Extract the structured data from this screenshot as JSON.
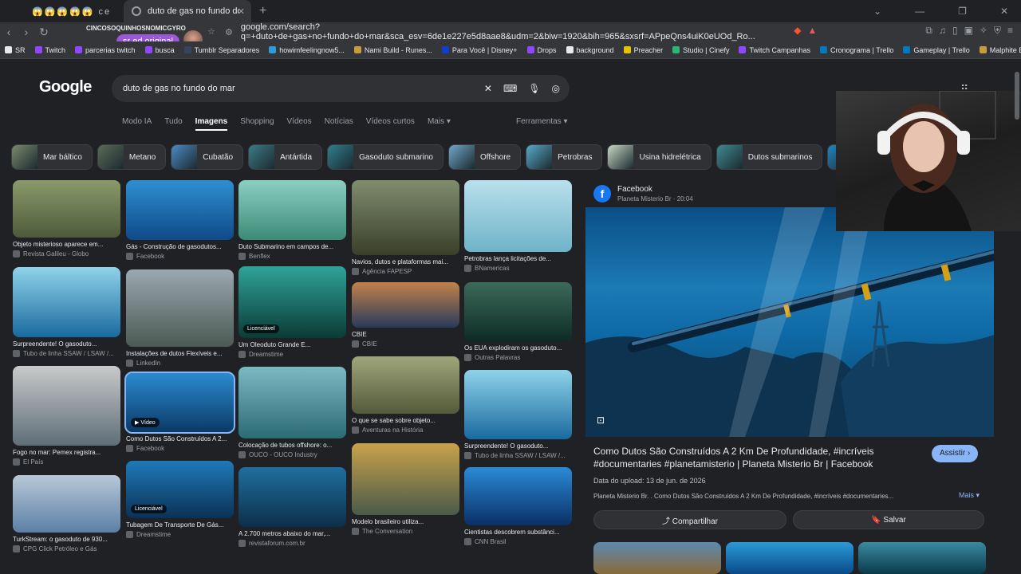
{
  "browser": {
    "tabs": [
      {
        "title": "😱😱😱😱😱 ce",
        "active": false
      },
      {
        "title": "duto de gas no fundo do mar - Pe",
        "active": true
      }
    ],
    "overlay_text": "CINCOSOQUINHOSNOMICGYRO",
    "stream_pill": "sr ed original",
    "url": "google.com/search?q=+duto+de+gas+no+fundo+do+mar&sca_esv=6de1e227e5d8aae8&udm=2&biw=1920&bih=965&sxsrf=APpeQns4uiK0eUOd_Ro...",
    "bookmarks": [
      {
        "label": "SR",
        "color": "#e8eaed"
      },
      {
        "label": "Twitch",
        "color": "#9146ff"
      },
      {
        "label": "parcerias twitch",
        "color": "#9146ff"
      },
      {
        "label": "busca",
        "color": "#9146ff"
      },
      {
        "label": "Tumblr Separadores",
        "color": "#35465c"
      },
      {
        "label": "howimfeelingnow5...",
        "color": "#2d9cdb"
      },
      {
        "label": "Nami Build - Runes...",
        "color": "#c89b3c"
      },
      {
        "label": "Para Você | Disney+",
        "color": "#113ccf"
      },
      {
        "label": "Drops",
        "color": "#9146ff"
      },
      {
        "label": "background",
        "color": "#e8eaed"
      },
      {
        "label": "Preacher",
        "color": "#e6c300"
      },
      {
        "label": "Studio | Cinefy",
        "color": "#2bb673"
      },
      {
        "label": "Twitch Campanhas",
        "color": "#9146ff"
      },
      {
        "label": "Cronograma | Trello",
        "color": "#0079bf"
      },
      {
        "label": "Gameplay | Trello",
        "color": "#0079bf"
      },
      {
        "label": "Malphite Build - Ru...",
        "color": "#c89b3c"
      }
    ]
  },
  "search": {
    "logo": "Google",
    "query": "duto de gas no fundo do mar",
    "tabs": [
      "Modo IA",
      "Tudo",
      "Imagens",
      "Shopping",
      "Vídeos",
      "Notícias",
      "Vídeos curtos",
      "Mais ▾"
    ],
    "selected_tab": "Imagens",
    "tools": "Ferramentas ▾"
  },
  "chips": [
    {
      "label": "Mar báltico",
      "color": "#7b8a6a"
    },
    {
      "label": "Metano",
      "color": "#5c6b55"
    },
    {
      "label": "Cubatão",
      "color": "#4d89c4"
    },
    {
      "label": "Antártida",
      "color": "#3c7c86"
    },
    {
      "label": "Gasoduto submarino",
      "color": "#2f7e8e"
    },
    {
      "label": "Offshore",
      "color": "#6fa7c7"
    },
    {
      "label": "Petrobras",
      "color": "#57a9c9"
    },
    {
      "label": "Usina hidrelétrica",
      "color": "#c9d6c3"
    },
    {
      "label": "Dutos submarinos",
      "color": "#3f8a8f"
    },
    {
      "label": "T",
      "color": "#1f86c2"
    }
  ],
  "results": [
    {
      "caption": "Objeto misterioso aparece em...",
      "source": "Revista Galileu - Globo",
      "badge": "",
      "colors": [
        "#8a9a6a",
        "#4d5a3a"
      ]
    },
    {
      "caption": "Surpreendente! O gasoduto...",
      "source": "Tubo de linha SSAW / LSAW /...",
      "badge": "",
      "colors": [
        "#8fd3ea",
        "#1a6aa0"
      ]
    },
    {
      "caption": "Fogo no mar: Pemex registra...",
      "source": "El País",
      "badge": "",
      "colors": [
        "#c9c9c9",
        "#5e6e78"
      ]
    },
    {
      "caption": "TurkStream: o gasoduto de 930...",
      "source": "CPG Click Petróleo e Gás",
      "badge": "",
      "colors": [
        "#b8c9d8",
        "#5b7fa5"
      ]
    },
    {
      "caption": "Gás - Construção de gasodutos...",
      "source": "Facebook",
      "badge": "",
      "colors": [
        "#2e8fd0",
        "#0f4a8a"
      ]
    },
    {
      "caption": "Instalações de dutos Flexíveis e...",
      "source": "LinkedIn",
      "badge": "",
      "colors": [
        "#9aa8b0",
        "#4b5a52"
      ]
    },
    {
      "caption": "Como Dutos São Construídos A 2...",
      "source": "Facebook",
      "badge": "▶ Vídeo",
      "colors": [
        "#2b8bd0",
        "#0b3a66"
      ]
    },
    {
      "caption": "Tubagem De Transporte De Gás...",
      "source": "Dreamstime",
      "badge": "Licenciável",
      "colors": [
        "#1e7ab8",
        "#0a3257"
      ]
    },
    {
      "caption": "Duto Submarino em campos de...",
      "source": "Benflex",
      "badge": "",
      "colors": [
        "#8ccfc3",
        "#3c8a78"
      ]
    },
    {
      "caption": "Um Oleoduto Grande E...",
      "source": "Dreamstime",
      "badge": "Licenciável",
      "colors": [
        "#2fa39a",
        "#0b3b36"
      ]
    },
    {
      "caption": "Colocação de tubos offshore: o...",
      "source": "OUCO - OUCO Industry",
      "badge": "",
      "colors": [
        "#7ab9c2",
        "#2b6b76"
      ]
    },
    {
      "caption": "A 2.700 metros abaixo do mar,...",
      "source": "revistaforum.com.br",
      "badge": "",
      "colors": [
        "#1f6fa0",
        "#0c2f4a"
      ]
    },
    {
      "caption": "Navios, dutos e plataformas mai...",
      "source": "Agência FAPESP",
      "badge": "",
      "colors": [
        "#7f8d6e",
        "#3a3f2a"
      ]
    },
    {
      "caption": "CBIE",
      "source": "CBIE",
      "badge": "",
      "colors": [
        "#c2824a",
        "#283a5a"
      ]
    },
    {
      "caption": "O que se sabe sobre objeto...",
      "source": "Aventuras na História",
      "badge": "",
      "colors": [
        "#9fa67a",
        "#545a3a"
      ]
    },
    {
      "caption": "Modelo brasileiro utiliza...",
      "source": "The Conversation",
      "badge": "",
      "colors": [
        "#c9a24a",
        "#4a5a4a"
      ]
    },
    {
      "caption": "Petrobras lança licitações de...",
      "source": "BNamericas",
      "badge": "",
      "colors": [
        "#b9e0ec",
        "#6fb3c9"
      ]
    },
    {
      "caption": "Os EUA explodiram os gasoduto...",
      "source": "Outras Palavras",
      "badge": "",
      "colors": [
        "#3c6a5a",
        "#0d2b24"
      ]
    },
    {
      "caption": "Surpreendente! O gasoduto...",
      "source": "Tubo de linha SSAW / LSAW /...",
      "badge": "",
      "colors": [
        "#8fd3ea",
        "#1a6aa0"
      ]
    },
    {
      "caption": "Cientistas descobrem substânci...",
      "source": "CNN Brasil",
      "badge": "",
      "colors": [
        "#2a8bd6",
        "#0a2f66"
      ]
    }
  ],
  "panel": {
    "site": "Facebook",
    "sub": "Planeta Misterio Br · 20:04",
    "title": "Como Dutos São Construídos A 2 Km De Profundidade, #incríveis #documentaries #planetamisterio | Planeta Misterio Br | Facebook",
    "assist": "Assistir ›",
    "upload": "Data do upload: 13 de jun. de 2026",
    "description": "Planeta Misterio Br. . Como Dutos São Construídos A 2 Km De Profundidade, #incríveis #documentaries...",
    "more": "Mais ▾",
    "share": "⤴ Compartilhar",
    "save": "🔖 Salvar"
  }
}
